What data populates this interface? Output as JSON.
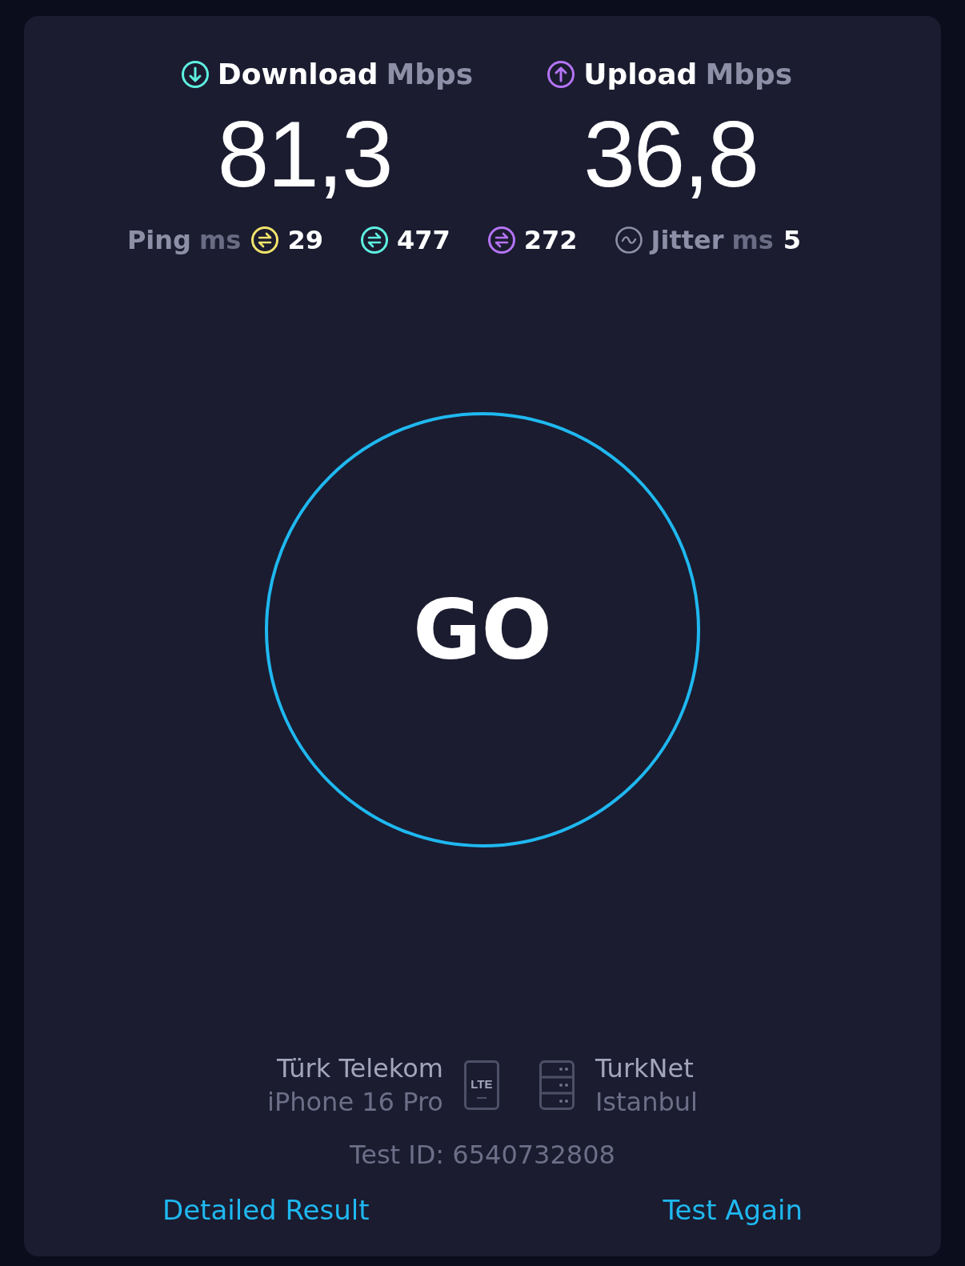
{
  "metrics": [
    {
      "kind": "download",
      "label": "Download",
      "unit": "Mbps",
      "value": "81,3",
      "color": "#5ef0e0"
    },
    {
      "kind": "upload",
      "label": "Upload",
      "unit": "Mbps",
      "value": "36,8",
      "color": "#b574f5"
    }
  ],
  "ping": {
    "label": "Ping",
    "unit": "ms",
    "readings": [
      {
        "value": "29",
        "color": "#f2e46b"
      },
      {
        "value": "477",
        "color": "#5ef0e0"
      },
      {
        "value": "272",
        "color": "#b574f5"
      }
    ]
  },
  "jitter": {
    "label": "Jitter",
    "unit": "ms",
    "value": "5"
  },
  "go_button": "GO",
  "provider": {
    "name": "Türk Telekom",
    "device": "iPhone 16 Pro",
    "network_badge": "LTE"
  },
  "server": {
    "name": "TurkNet",
    "location": "Istanbul"
  },
  "test_id": "Test ID: 6540732808",
  "links": [
    "Detailed Result",
    "Test Again"
  ]
}
